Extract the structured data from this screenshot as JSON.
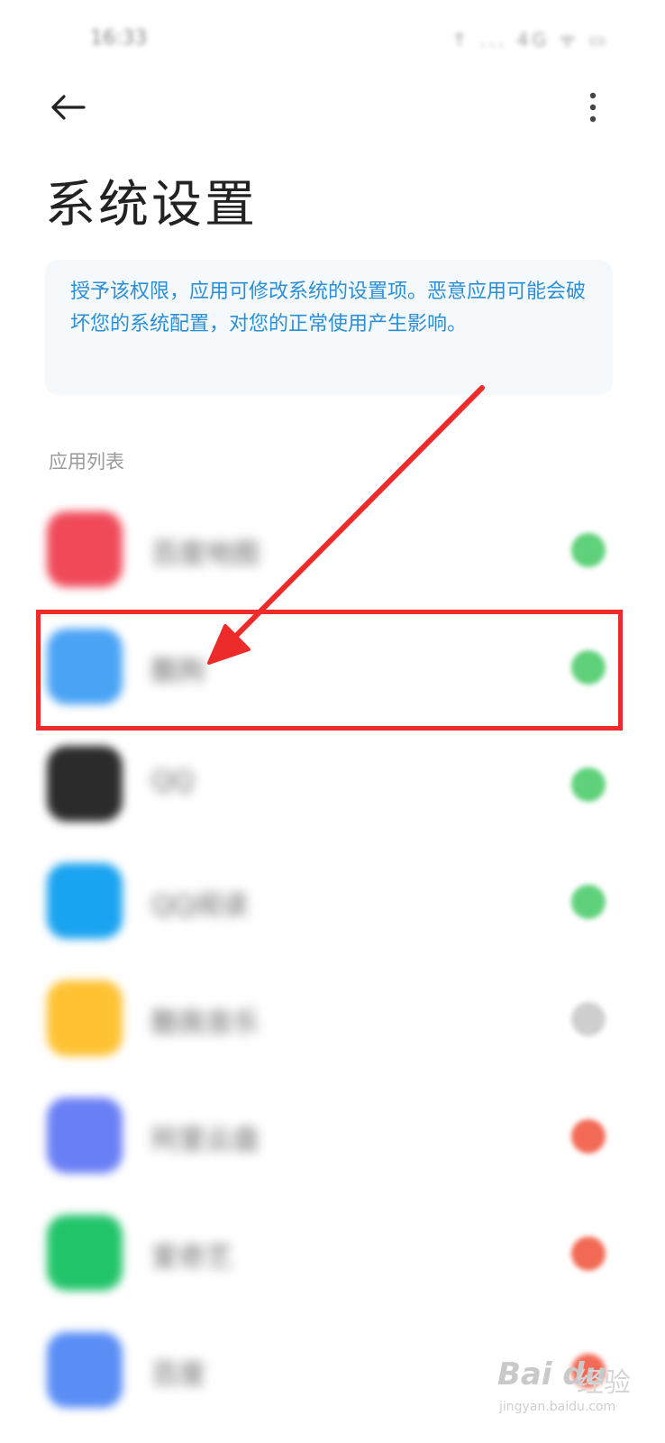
{
  "status_bar": {
    "time": "16:33",
    "icons": "↑ ... 4G ᯤ ▭"
  },
  "header": {
    "title": "系统设置"
  },
  "info_card": {
    "text": "授予该权限，应用可修改系统的设置项。恶意应用可能会破坏您的系统配置，对您的正常使用产生影响。"
  },
  "section": {
    "label": "应用列表"
  },
  "apps": [
    {
      "name": "百度地图",
      "icon_color": "#f04a5a",
      "toggle_color": "#5fd17a"
    },
    {
      "name": "酷狗",
      "icon_color": "#4aa3f5",
      "toggle_color": "#5fd17a"
    },
    {
      "name": "QQ",
      "icon_color": "#2b2b2b",
      "toggle_color": "#5fd17a"
    },
    {
      "name": "QQ阅读",
      "icon_color": "#1aa3f0",
      "toggle_color": "#5fd17a"
    },
    {
      "name": "酷我音乐",
      "icon_color": "#ffc233",
      "toggle_color": "#cfcfcf"
    },
    {
      "name": "阿里云盘",
      "icon_color": "#6a7ff5",
      "toggle_color": "#f26a55"
    },
    {
      "name": "爱奇艺",
      "icon_color": "#22c46a",
      "toggle_color": "#f26a55"
    },
    {
      "name": "百度",
      "icon_color": "#5a8ef5",
      "toggle_color": "#f26a55"
    }
  ],
  "annotation": {
    "color": "#ee2b2b"
  },
  "watermark": {
    "brand": "Bai du",
    "jingyan": "经验",
    "url": "jingyan.baidu.com"
  }
}
